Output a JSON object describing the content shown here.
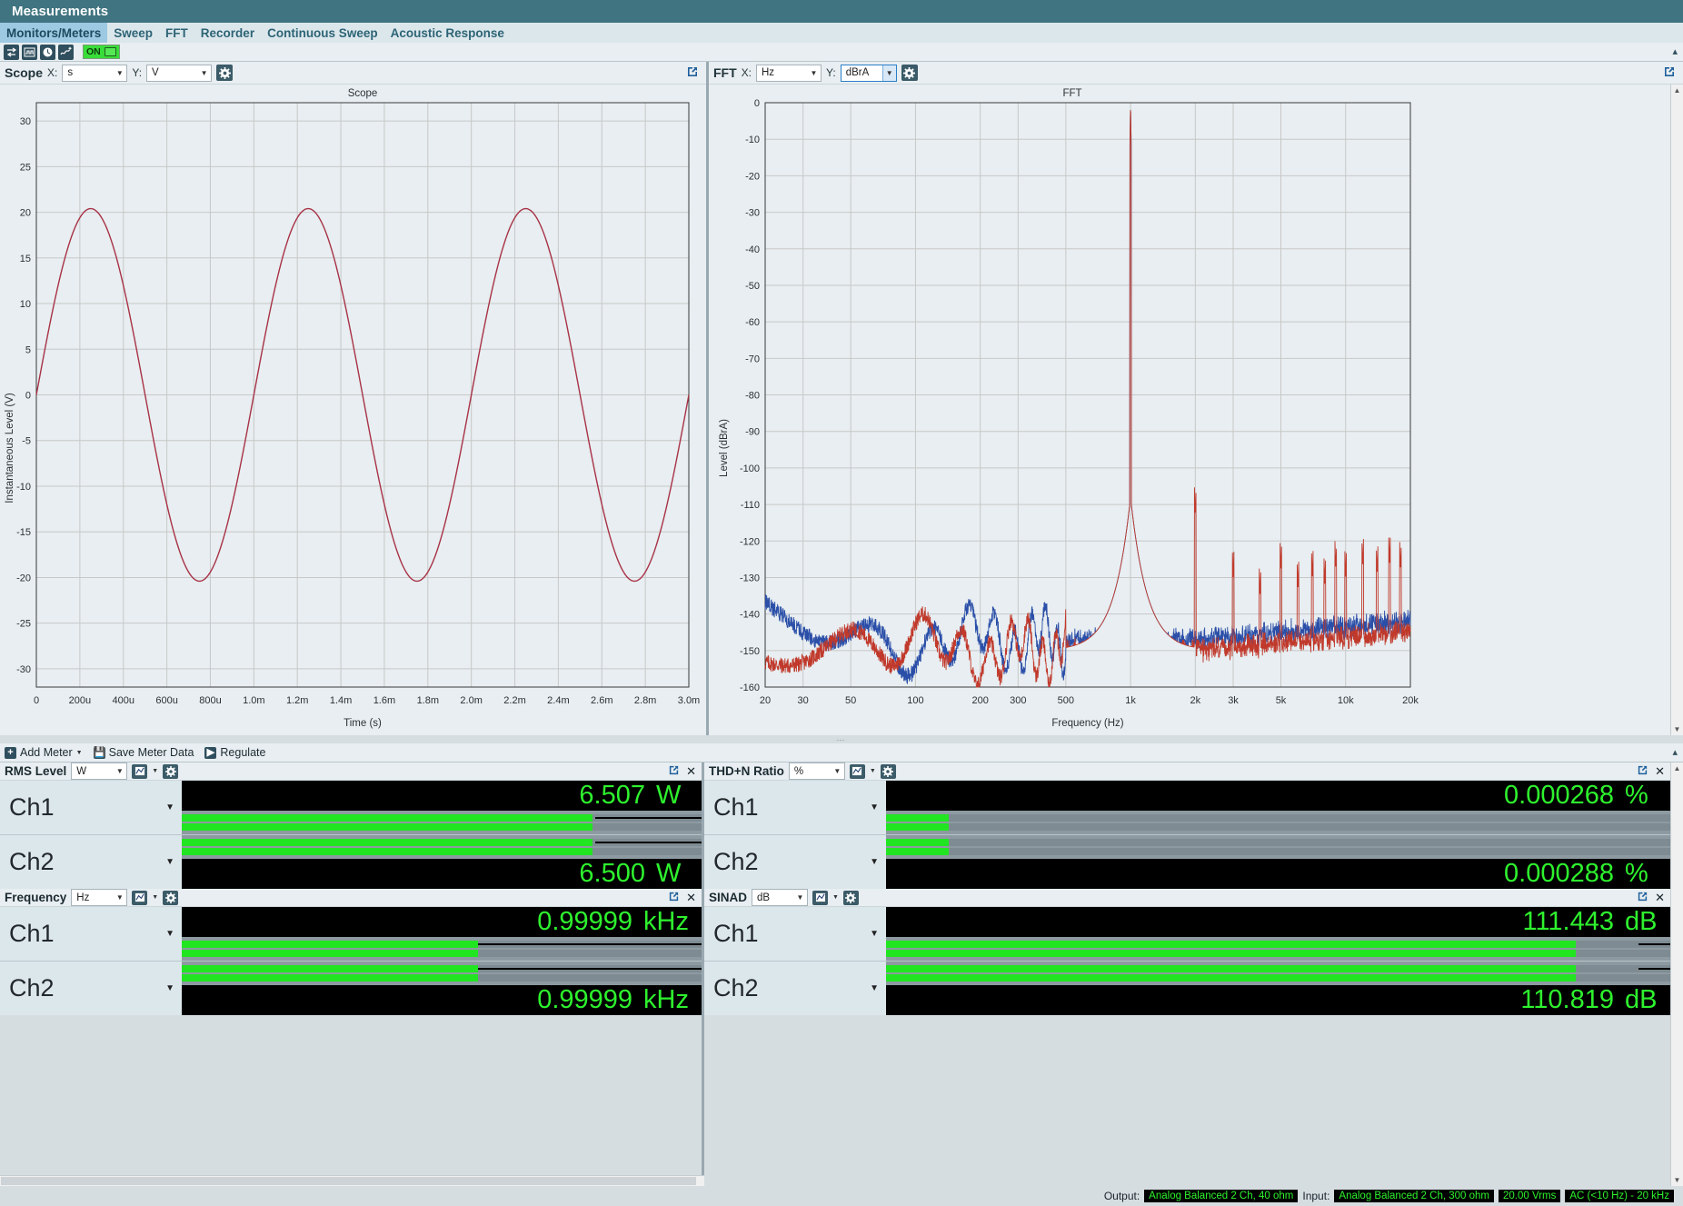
{
  "window": {
    "title": "Measurements"
  },
  "menubar": {
    "items": [
      {
        "label": "Monitors/Meters",
        "active": true
      },
      {
        "label": "Sweep",
        "active": false
      },
      {
        "label": "FFT",
        "active": false
      },
      {
        "label": "Recorder",
        "active": false
      },
      {
        "label": "Continuous Sweep",
        "active": false
      },
      {
        "label": "Acoustic Response",
        "active": false
      }
    ]
  },
  "toolbar": {
    "icons": [
      "transfer-icon",
      "waveform-icon",
      "clock-icon",
      "trend-add-icon"
    ],
    "on_label": "ON"
  },
  "scope_panel": {
    "name": "Scope",
    "x_label": "X:",
    "x_unit": "s",
    "y_label": "Y:",
    "y_unit": "V",
    "chart_title": "Scope"
  },
  "fft_panel": {
    "name": "FFT",
    "x_label": "X:",
    "x_unit": "Hz",
    "y_label": "Y:",
    "y_unit": "dBrA",
    "chart_title": "FFT"
  },
  "meter_toolbar": {
    "add_meter": "Add Meter",
    "save_meter_data": "Save Meter Data",
    "regulate": "Regulate"
  },
  "meters": [
    {
      "name": "RMS Level",
      "unit": "W",
      "rows": [
        {
          "channel": "Ch1",
          "value": "6.507",
          "unit": "W",
          "bar_pct": 79,
          "needle_pct": 79.5
        },
        {
          "channel": "Ch2",
          "value": "6.500",
          "unit": "W",
          "bar_pct": 79,
          "needle_pct": 79.5
        }
      ]
    },
    {
      "name": "THD+N Ratio",
      "unit": "%",
      "rows": [
        {
          "channel": "Ch1",
          "value": "0.000268",
          "unit": "%",
          "bar_pct": 8,
          "needle_pct": 100
        },
        {
          "channel": "Ch2",
          "value": "0.000288",
          "unit": "%",
          "bar_pct": 8,
          "needle_pct": 100
        }
      ]
    },
    {
      "name": "Frequency",
      "unit": "Hz",
      "rows": [
        {
          "channel": "Ch1",
          "value": "0.99999",
          "unit": "kHz",
          "bar_pct": 57,
          "needle_pct": 57
        },
        {
          "channel": "Ch2",
          "value": "0.99999",
          "unit": "kHz",
          "bar_pct": 57,
          "needle_pct": 57
        }
      ]
    },
    {
      "name": "SINAD",
      "unit": "dB",
      "rows": [
        {
          "channel": "Ch1",
          "value": "111.443",
          "unit": "dB",
          "bar_pct": 88,
          "needle_pct": 96
        },
        {
          "channel": "Ch2",
          "value": "110.819",
          "unit": "dB",
          "bar_pct": 88,
          "needle_pct": 96
        }
      ]
    }
  ],
  "statusbar": {
    "output_label": "Output:",
    "output_value": "Analog Balanced 2 Ch, 40 ohm",
    "input_label": "Input:",
    "input_value": "Analog Balanced 2 Ch, 300 ohm",
    "level_value": "20.00 Vrms",
    "bandwidth_value": "AC (<10 Hz) - 20 kHz"
  },
  "chart_data": [
    {
      "type": "line",
      "title": "Scope",
      "xlabel": "Time (s)",
      "ylabel": "Instantaneous Level (V)",
      "xlim": [
        0,
        0.003
      ],
      "ylim": [
        -32,
        32
      ],
      "grid": true,
      "legend": "none",
      "x_ticks": [
        "0",
        "200u",
        "400u",
        "600u",
        "800u",
        "1.0m",
        "1.2m",
        "1.4m",
        "1.6m",
        "1.8m",
        "2.0m",
        "2.2m",
        "2.4m",
        "2.6m",
        "2.8m",
        "3.0m"
      ],
      "y_ticks": [
        "30",
        "25",
        "20",
        "15",
        "10",
        "5",
        "0",
        "-5",
        "-10",
        "-15",
        "-20",
        "-25",
        "-30"
      ],
      "series": [
        {
          "name": "Ch1",
          "color": "#a83246",
          "waveform": "sine",
          "amplitude_v": 20.4,
          "frequency_hz": 1000,
          "phase_deg": 0,
          "cycles": 3
        },
        {
          "name": "Ch2",
          "color": "#2b4fa8",
          "waveform": "sine",
          "amplitude_v": 20.4,
          "frequency_hz": 1000,
          "phase_deg": 0,
          "cycles": 3
        }
      ]
    },
    {
      "type": "line",
      "title": "FFT",
      "xlabel": "Frequency (Hz)",
      "ylabel": "Level (dBrA)",
      "xscale": "log",
      "xlim": [
        20,
        20000
      ],
      "ylim": [
        -160,
        0
      ],
      "grid": true,
      "legend": "none",
      "x_ticks": [
        "20",
        "30",
        "50",
        "100",
        "200",
        "300",
        "500",
        "1k",
        "2k",
        "3k",
        "5k",
        "10k",
        "20k"
      ],
      "y_ticks": [
        "0",
        "-10",
        "-20",
        "-30",
        "-40",
        "-50",
        "-60",
        "-70",
        "-80",
        "-90",
        "-100",
        "-110",
        "-120",
        "-130",
        "-140",
        "-150",
        "-160"
      ],
      "series": [
        {
          "name": "Ch1",
          "color": "#c0392b",
          "noise_floor_dbra": -150,
          "fundamental_hz": 1000,
          "fundamental_dbra": 0,
          "harmonics": [
            {
              "hz": 2000,
              "dbra": -113
            },
            {
              "hz": 3000,
              "dbra": -130
            },
            {
              "hz": 4000,
              "dbra": -135
            },
            {
              "hz": 5000,
              "dbra": -128
            },
            {
              "hz": 6000,
              "dbra": -133
            },
            {
              "hz": 7000,
              "dbra": -130
            },
            {
              "hz": 8000,
              "dbra": -132
            },
            {
              "hz": 9000,
              "dbra": -128
            },
            {
              "hz": 10000,
              "dbra": -130
            },
            {
              "hz": 12000,
              "dbra": -127
            },
            {
              "hz": 14000,
              "dbra": -129
            },
            {
              "hz": 16000,
              "dbra": -126
            },
            {
              "hz": 18000,
              "dbra": -128
            }
          ]
        },
        {
          "name": "Ch2",
          "color": "#2b4fa8",
          "noise_floor_dbra": -147,
          "fundamental_hz": 1000,
          "fundamental_dbra": 0,
          "harmonics": []
        }
      ]
    }
  ]
}
